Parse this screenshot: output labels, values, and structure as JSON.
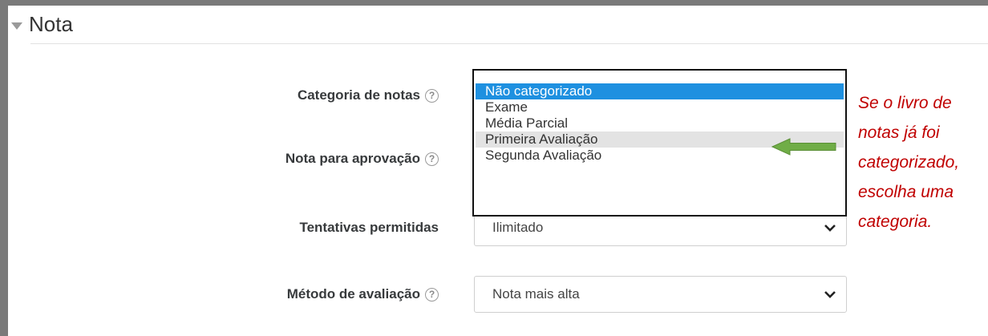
{
  "section": {
    "title": "Nota"
  },
  "fields": {
    "category_label": "Categoria de notas",
    "passing_grade_label": "Nota para aprovação",
    "attempts_label": "Tentativas permitidas",
    "grading_method_label": "Método de avaliação"
  },
  "category_options": [
    "Não categorizado",
    "Exame",
    "Média Parcial",
    "Primeira Avaliação",
    "Segunda Avaliação"
  ],
  "category_selected": "Não categorizado",
  "attempts_value": "Ilimitado",
  "grading_method_value": "Nota mais alta",
  "help_icon_glyph": "?",
  "annotation": {
    "lines": [
      "Se o livro de",
      "notas já foi",
      "categorizado,",
      "escolha uma",
      "categoria."
    ],
    "color": "#c00000"
  },
  "arrow": {
    "color": "#70ad47",
    "icon": "arrow-left-icon"
  }
}
